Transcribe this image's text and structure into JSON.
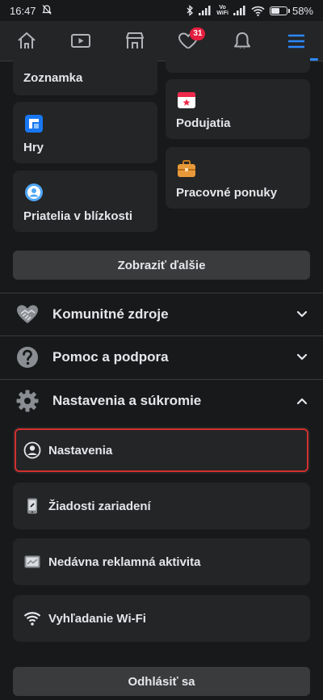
{
  "status_bar": {
    "time": "16:47",
    "volte_line1": "Vo",
    "volte_line2": "WiFi",
    "battery_percent": "58%",
    "battery_level": 0.58
  },
  "nav": {
    "tabs": [
      {
        "icon": "home-icon"
      },
      {
        "icon": "video-icon"
      },
      {
        "icon": "marketplace-icon"
      },
      {
        "icon": "heart-icon",
        "badge": "31"
      },
      {
        "icon": "bell-icon"
      },
      {
        "icon": "menu-icon",
        "active": true
      }
    ]
  },
  "shortcuts": {
    "dating": "Zoznamka",
    "events": "Podujatia",
    "games": "Hry",
    "jobs": "Pracovné ponuky",
    "nearby_friends": "Priatelia v blízkosti",
    "see_more": "Zobraziť ďalšie"
  },
  "sections": {
    "community": "Komunitné zdroje",
    "help": "Pomoc a podpora",
    "settings_privacy": "Nastavenia a súkromie"
  },
  "settings_items": {
    "settings": "Nastavenia",
    "device_requests": "Žiadosti zariadení",
    "ad_activity": "Nedávna reklamná aktivita",
    "wifi_finder": "Vyhľadanie Wi-Fi"
  },
  "logout": "Odhlásiť sa",
  "colors": {
    "accent": "#2d88ff",
    "badge": "#e41e3f",
    "highlight": "#d32f2f",
    "background": "#18191a",
    "card": "#242526"
  }
}
